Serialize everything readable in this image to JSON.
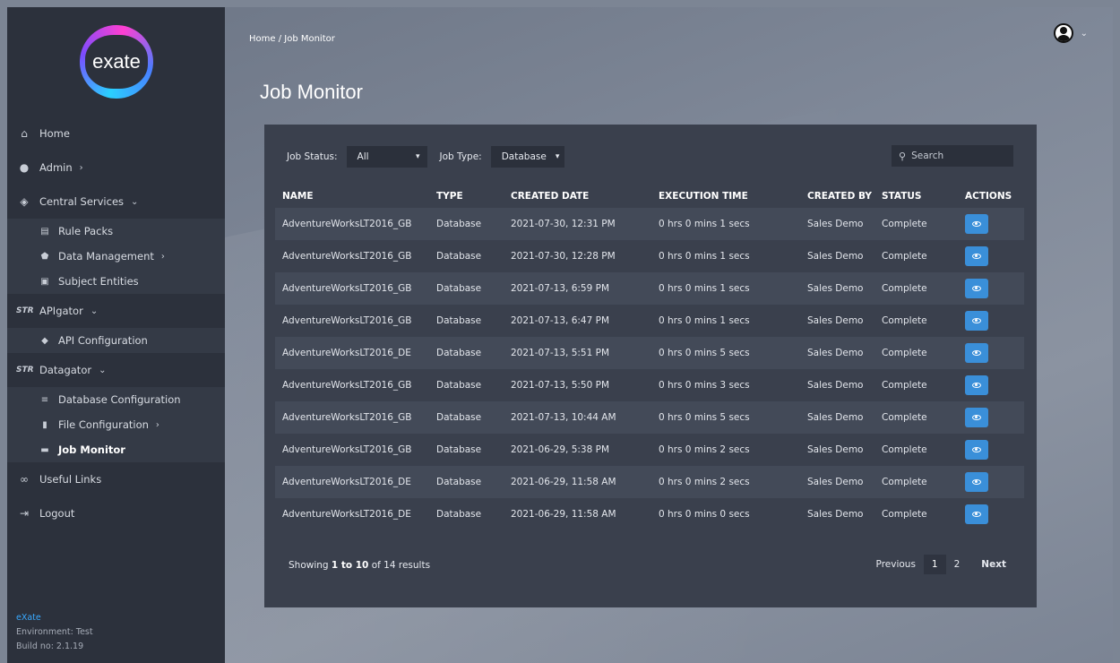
{
  "brand": {
    "logo_text": "exate",
    "accent": "#39a9ff"
  },
  "sidebar": {
    "items": [
      {
        "label": "Home",
        "icon": "home-icon"
      },
      {
        "label": "Admin",
        "icon": "users-icon"
      },
      {
        "label": "Central Services",
        "icon": "layers-icon"
      },
      {
        "label": "APIgator",
        "icon": "str-logo-icon"
      },
      {
        "label": "Datagator",
        "icon": "str-logo-icon"
      },
      {
        "label": "Useful Links",
        "icon": "link-icon"
      },
      {
        "label": "Logout",
        "icon": "logout-icon"
      }
    ],
    "central_services": [
      {
        "label": "Rule Packs",
        "icon": "list-icon"
      },
      {
        "label": "Data Management",
        "icon": "shield-icon"
      },
      {
        "label": "Subject Entities",
        "icon": "document-icon"
      }
    ],
    "apigator": [
      {
        "label": "API Configuration",
        "icon": "cube-icon"
      }
    ],
    "datagator": [
      {
        "label": "Database Configuration",
        "icon": "database-icon"
      },
      {
        "label": "File Configuration",
        "icon": "file-icon"
      },
      {
        "label": "Job Monitor",
        "icon": "briefcase-icon"
      }
    ],
    "footer": {
      "brand": "eXate",
      "environment": "Environment: Test",
      "build": "Build no: 2.1.19"
    }
  },
  "breadcrumb": "Home /  Job Monitor",
  "page_title": "Job Monitor",
  "filters": {
    "job_status_label": "Job Status:",
    "job_status_value": "All",
    "job_type_label": "Job Type:",
    "job_type_value": "Database"
  },
  "search": {
    "placeholder": "Search"
  },
  "table": {
    "headers": [
      "NAME",
      "TYPE",
      "CREATED DATE",
      "EXECUTION TIME",
      "CREATED BY",
      "STATUS",
      "ACTIONS"
    ],
    "rows": [
      [
        "AdventureWorksLT2016_GB",
        "Database",
        "2021-07-30, 12:31 PM",
        "0 hrs 0 mins 1 secs",
        "Sales Demo",
        "Complete"
      ],
      [
        "AdventureWorksLT2016_GB",
        "Database",
        "2021-07-30, 12:28 PM",
        "0 hrs 0 mins 1 secs",
        "Sales Demo",
        "Complete"
      ],
      [
        "AdventureWorksLT2016_GB",
        "Database",
        "2021-07-13, 6:59 PM",
        "0 hrs 0 mins 1 secs",
        "Sales Demo",
        "Complete"
      ],
      [
        "AdventureWorksLT2016_GB",
        "Database",
        "2021-07-13, 6:47 PM",
        "0 hrs 0 mins 1 secs",
        "Sales Demo",
        "Complete"
      ],
      [
        "AdventureWorksLT2016_DE",
        "Database",
        "2021-07-13, 5:51 PM",
        "0 hrs 0 mins 5 secs",
        "Sales Demo",
        "Complete"
      ],
      [
        "AdventureWorksLT2016_GB",
        "Database",
        "2021-07-13, 5:50 PM",
        "0 hrs 0 mins 3 secs",
        "Sales Demo",
        "Complete"
      ],
      [
        "AdventureWorksLT2016_GB",
        "Database",
        "2021-07-13, 10:44 AM",
        "0 hrs 0 mins 5 secs",
        "Sales Demo",
        "Complete"
      ],
      [
        "AdventureWorksLT2016_GB",
        "Database",
        "2021-06-29, 5:38 PM",
        "0 hrs 0 mins 2 secs",
        "Sales Demo",
        "Complete"
      ],
      [
        "AdventureWorksLT2016_DE",
        "Database",
        "2021-06-29, 11:58 AM",
        "0 hrs 0 mins 2 secs",
        "Sales Demo",
        "Complete"
      ],
      [
        "AdventureWorksLT2016_DE",
        "Database",
        "2021-06-29, 11:58 AM",
        "0 hrs 0 mins 0 secs",
        "Sales Demo",
        "Complete"
      ]
    ]
  },
  "pagination": {
    "showing_prefix": "Showing ",
    "range": "1 to 10",
    "suffix": " of 14 results",
    "previous": "Previous",
    "pages": [
      "1",
      "2"
    ],
    "next": "Next"
  }
}
